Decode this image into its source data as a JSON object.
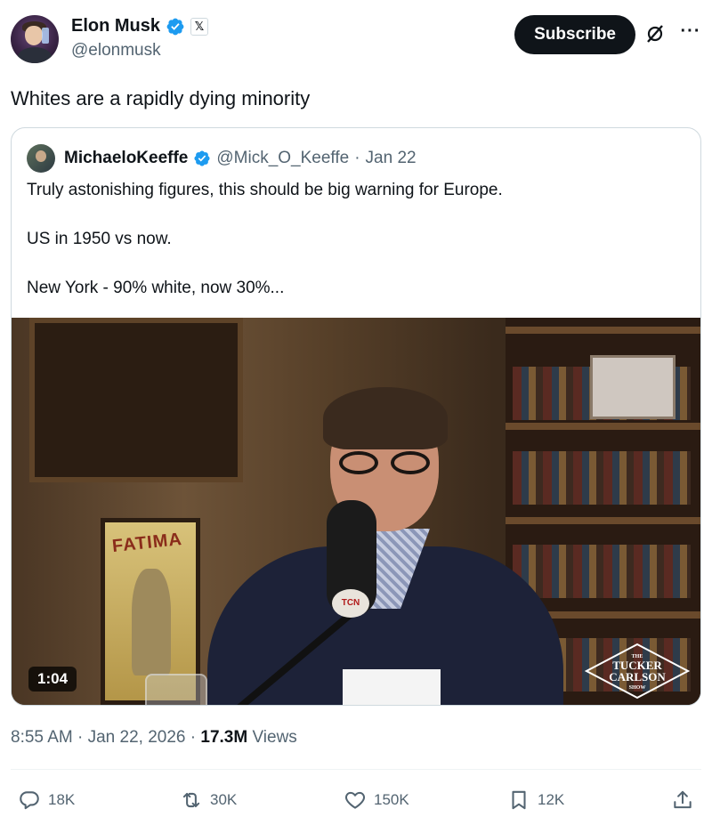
{
  "author": {
    "name": "Elon Musk",
    "handle": "@elonmusk",
    "affiliate_badge": "𝕏"
  },
  "header": {
    "subscribe_label": "Subscribe",
    "grok_icon": "grok-icon",
    "more_icon": "more-icon",
    "more_glyph": "···"
  },
  "tweet": {
    "text": "Whites are a rapidly dying minority"
  },
  "quoted": {
    "name": "MichaeloKeeffe",
    "handle": "@Mick_O_Keeffe",
    "separator": "·",
    "date": "Jan 22",
    "lines": [
      "Truly astonishing figures, this should be big warning for Europe.",
      "US in 1950 vs now.",
      "New York - 90% white, now 30%..."
    ],
    "video": {
      "duration": "1:04",
      "poster_text": "FATIMA",
      "mic_logo": "TCN",
      "show_logo": {
        "top": "THE",
        "line1": "TUCKER",
        "line2": "CARLSON",
        "bottom": "SHOW"
      }
    }
  },
  "meta": {
    "time": "8:55 AM",
    "dot1": "·",
    "date": "Jan 22, 2026",
    "dot2": "·",
    "views_count": "17.3M",
    "views_label": "Views"
  },
  "actions": {
    "replies": "18K",
    "reposts": "30K",
    "likes": "150K",
    "bookmarks": "12K"
  },
  "colors": {
    "verified": "#1d9bf0",
    "text": "#0f1419",
    "secondary": "#536471",
    "border": "#cfd9de"
  }
}
